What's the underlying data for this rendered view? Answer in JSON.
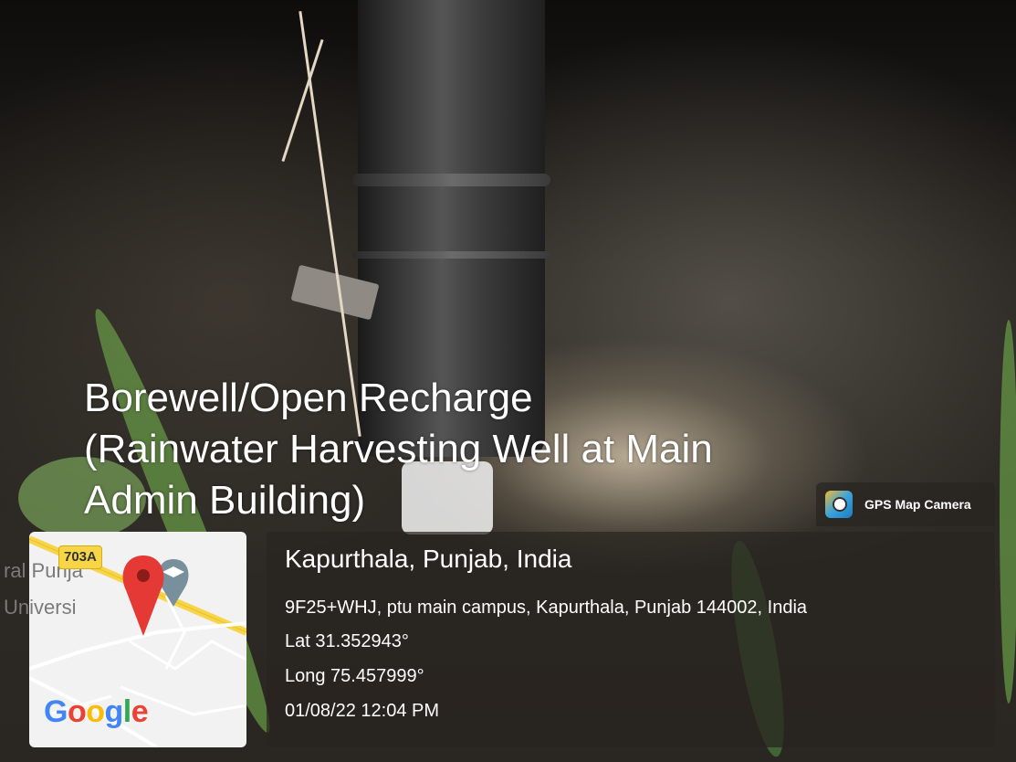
{
  "caption": {
    "line1": "Borewell/Open Recharge",
    "line2": "(Rainwater Harvesting Well at Main",
    "line3": "Admin Building)"
  },
  "badge": {
    "label": "GPS Map Camera",
    "icon": "gps-map-camera-icon"
  },
  "map": {
    "road_badge": "703A",
    "label_road_partial": "ral Punja",
    "label_uni_partial": "Universi",
    "logo": {
      "g1": "G",
      "o1": "o",
      "o2": "o",
      "g2": "g",
      "l": "l",
      "e": "e"
    },
    "pin_icon": "location-pin-icon",
    "place_icon": "graduation-cap-icon"
  },
  "info": {
    "title": "Kapurthala, Punjab, India",
    "address": "9F25+WHJ, ptu main campus, Kapurthala, Punjab 144002, India",
    "lat": "Lat 31.352943°",
    "long": "Long 75.457999°",
    "datetime": "01/08/22 12:04 PM"
  },
  "colors": {
    "pin": "#e53935",
    "road": "#f7d547",
    "panel": "#28241f"
  }
}
